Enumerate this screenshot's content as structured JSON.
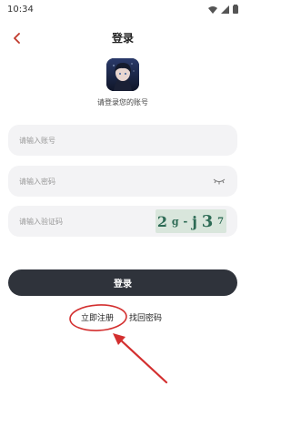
{
  "status": {
    "time": "10:34"
  },
  "header": {
    "title": "登录"
  },
  "subtitle": "请登录您的账号",
  "fields": {
    "account_placeholder": "请输入账号",
    "password_placeholder": "请输入密码",
    "captcha_placeholder": "请输入验证码"
  },
  "captcha": {
    "chars": [
      "2",
      "g",
      "-",
      "j",
      "3",
      "7"
    ]
  },
  "login_label": "登录",
  "links": {
    "register": "立即注册",
    "forgot": "找回密码"
  },
  "colors": {
    "accent": "#c0392b",
    "button": "#2f333b",
    "field_bg": "#f3f3f5",
    "annotation": "#d32f2f"
  }
}
